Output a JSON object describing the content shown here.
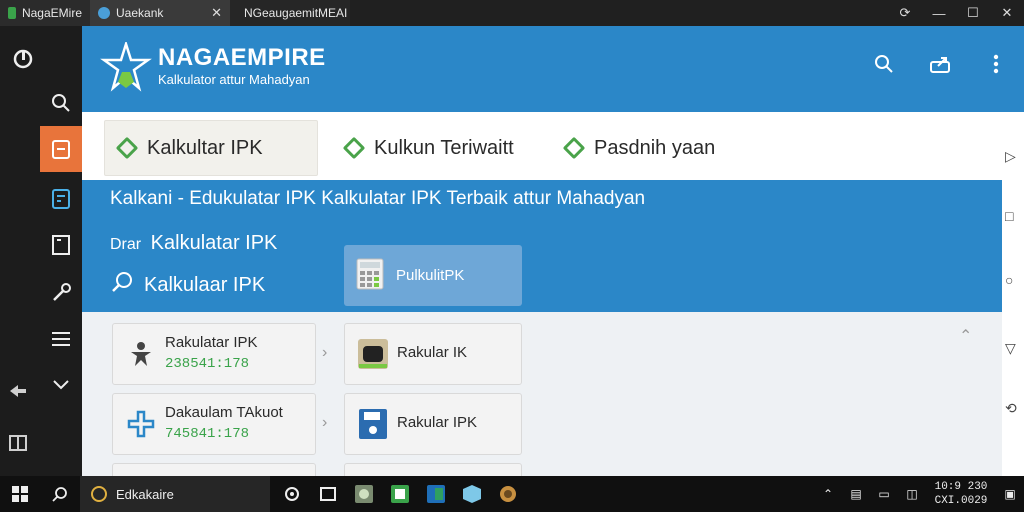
{
  "titlebar": {
    "tabs": [
      {
        "label": "NagaEMire"
      },
      {
        "label": "Uaekank",
        "close": "✕"
      },
      {
        "label": "NGeaugaemitMEAI"
      }
    ],
    "controls": [
      "⟳",
      "—",
      "☐",
      "✕"
    ]
  },
  "rail": {
    "items": [
      "power-icon",
      "search-icon",
      "clipboard-icon",
      "calculator-icon",
      "document-icon",
      "wrench-icon",
      "list-icon",
      "chevron-down-icon"
    ]
  },
  "app": {
    "brand": {
      "name": "NAGAEMPIRE",
      "subtitle": "Kalkulator attur Mahadyan"
    },
    "tabs": [
      {
        "label": "Kalkultar IPK"
      },
      {
        "label": "Kulkun Teriwaitt"
      },
      {
        "label": "Pasdnih yaan"
      }
    ],
    "banner": {
      "title": "Kalkani - Edukulatar IPK Kalkulatar IPK Terbaik attur Mahadyan",
      "line2_pre": "Drar",
      "line2": "Kalkulatar IPK",
      "line3": "Kalkulaar IPK",
      "card_label": "PulkulitPK"
    },
    "cards_left": [
      {
        "title": "Rakulatar IPK",
        "value": "238541:178"
      },
      {
        "title": "Dakaulam TAkuot",
        "value": "745841:178"
      }
    ],
    "cards_right": [
      {
        "label": "Rakular IK"
      },
      {
        "label": "Rakular IPK"
      }
    ]
  },
  "taskbar": {
    "search_label": "Edkakaire",
    "clock_time": "10:9 230",
    "clock_date": "CXI.0029"
  },
  "colors": {
    "accent": "#2b87c8",
    "rail_active": "#e8743b",
    "green": "#3aa34a"
  }
}
